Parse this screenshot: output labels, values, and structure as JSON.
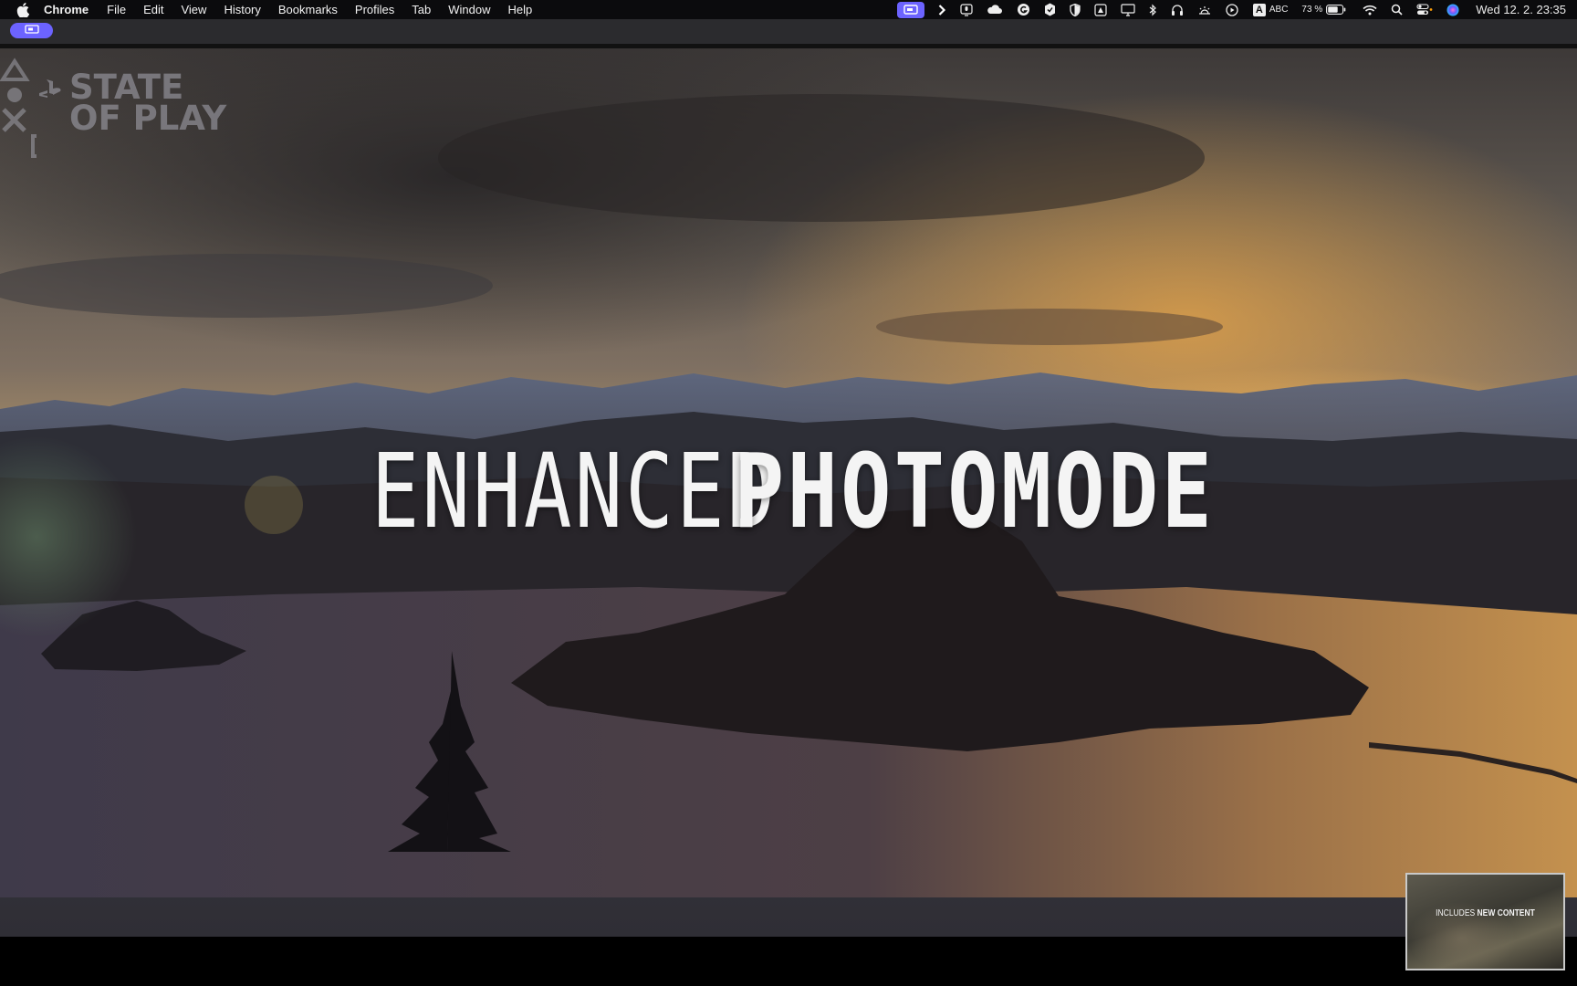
{
  "menubar": {
    "app_name": "Chrome",
    "menus": [
      "File",
      "Edit",
      "View",
      "History",
      "Bookmarks",
      "Profiles",
      "Tab",
      "Window",
      "Help"
    ],
    "status_icons": [
      "screen-mirror-icon",
      "chevron-right-icon",
      "mic-icon",
      "cloud-icon",
      "grammarly-icon",
      "shield-hex-icon",
      "shield-icon",
      "drive-icon",
      "display-icon",
      "bluetooth-icon",
      "headphones-icon",
      "brightness-icon",
      "play-circle-icon",
      "input-source-icon",
      "battery-icon",
      "wifi-icon",
      "search-icon",
      "control-center-icon",
      "siri-icon"
    ],
    "input_source_letter": "A",
    "input_source_label": "ABC",
    "battery_percent": "73 %",
    "clock": "Wed 12. 2.  23:35"
  },
  "video": {
    "brand_line1": "STATE",
    "brand_line2": "OF PLAY",
    "headline_light": "ENHANCED",
    "headline_bold": "PHOTOMODE",
    "thumbnail_light": "INCLUDES",
    "thumbnail_bold": "NEW CONTENT"
  },
  "colors": {
    "accent": "#6c63ff",
    "menubar_bg": "#0b0b0d",
    "tabstrip_bg": "#2b2b2e"
  }
}
